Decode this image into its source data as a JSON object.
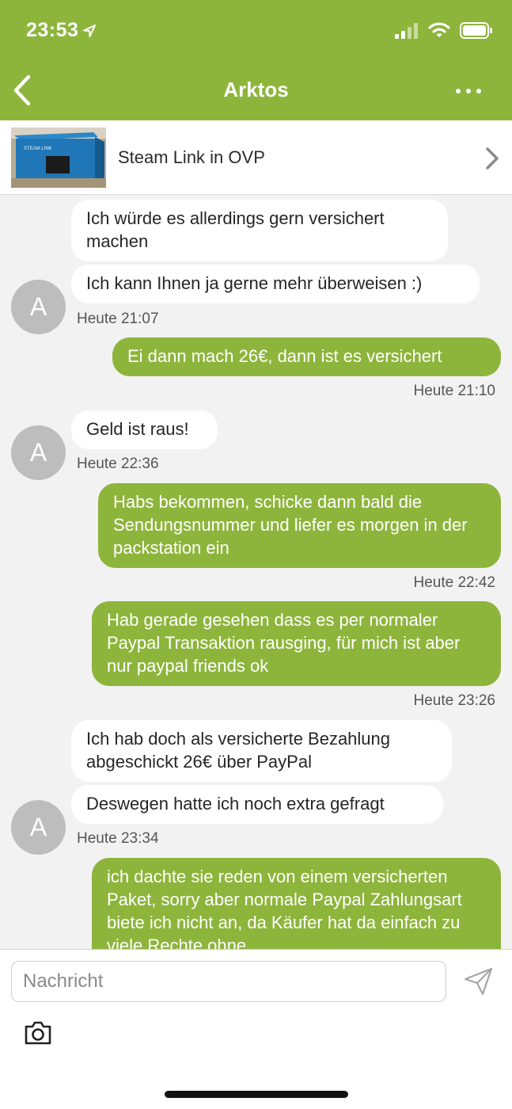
{
  "status_bar": {
    "time": "23:53"
  },
  "nav": {
    "title": "Arktos"
  },
  "listing": {
    "title": "Steam Link in OVP"
  },
  "messages": [
    {
      "dir": "in",
      "text": "Ich würde es allerdings gern versichert machen"
    },
    {
      "dir": "in",
      "text": "Ich kann Ihnen ja gerne mehr überweisen :)"
    },
    {
      "time": "Heute 21:07"
    },
    {
      "dir": "out",
      "text": "Ei dann mach 26€, dann ist es versichert"
    },
    {
      "time": "Heute 21:10"
    },
    {
      "dir": "in",
      "text": "Geld ist raus!"
    },
    {
      "time": "Heute 22:36"
    },
    {
      "dir": "out",
      "text": "Habs bekommen, schicke dann bald die Sendungsnummer und liefer es morgen in der packstation ein"
    },
    {
      "time": "Heute 22:42"
    },
    {
      "dir": "out",
      "text": "Hab gerade gesehen dass es per normaler Paypal Transaktion rausging, für mich ist aber nur paypal friends ok"
    },
    {
      "time": "Heute 23:26"
    },
    {
      "dir": "in",
      "text": "Ich hab doch als versicherte Bezahlung abgeschickt 26€ über PayPal"
    },
    {
      "dir": "in",
      "text": "Deswegen hatte ich noch extra gefragt"
    },
    {
      "time": "Heute 23:34"
    },
    {
      "dir": "out",
      "text": "ich dachte sie reden von einem versicherten Paket, sorry aber normale Paypal Zahlungsart biete ich nicht an, da Käufer hat da einfach zu viele Rechte ohne"
    }
  ],
  "avatar": {
    "initial": "A"
  },
  "composer": {
    "placeholder": "Nachricht"
  },
  "colors": {
    "brand_green": "#8db53c",
    "incoming_bubble": "#ffffff",
    "background": "#f2f2f2",
    "avatar_grey": "#bdbdbd"
  },
  "icons": [
    "location-arrow-icon",
    "signal-icon",
    "wifi-icon",
    "battery-icon",
    "back-chevron-icon",
    "more-dots-icon",
    "chevron-right-icon",
    "send-icon",
    "camera-icon"
  ]
}
